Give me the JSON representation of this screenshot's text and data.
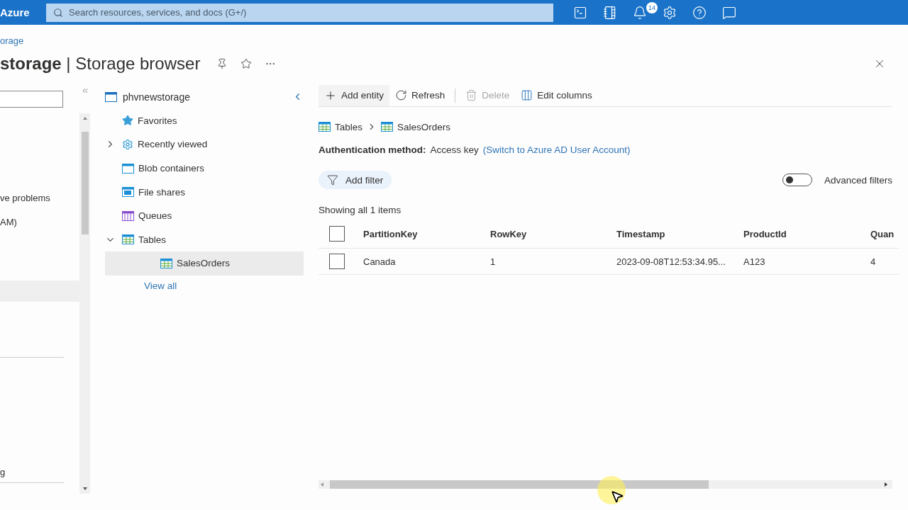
{
  "top_bar": {
    "brand": "Azure",
    "search": {
      "placeholder": "Search resources, services, and docs (G+/)"
    },
    "notification_count": "14"
  },
  "breadcrumb": "orage",
  "title": {
    "resource": "storage",
    "separator": " | ",
    "page": "Storage browser"
  },
  "left_nav": [
    {
      "label": "ve problems",
      "selected": false
    },
    {
      "label": "AM)",
      "selected": false
    },
    {
      "selected": true
    },
    {
      "label": "g",
      "selected": false
    }
  ],
  "tree": {
    "root": "phvnewstorage",
    "items": [
      {
        "kind": "favorites",
        "label": "Favorites",
        "selected": false
      },
      {
        "kind": "recent",
        "label": "Recently viewed",
        "expanded": false,
        "selected": false
      },
      {
        "kind": "blob",
        "label": "Blob containers",
        "selected": false
      },
      {
        "kind": "files",
        "label": "File shares",
        "selected": false
      },
      {
        "kind": "queue",
        "label": "Queues",
        "selected": false
      },
      {
        "kind": "table",
        "label": "Tables",
        "expanded": true,
        "selected": false,
        "children": [
          {
            "kind": "table",
            "label": "SalesOrders",
            "selected": true
          }
        ]
      }
    ],
    "view_all": "View all"
  },
  "toolbar": [
    {
      "kind": "add",
      "label": "Add entity",
      "disabled": false
    },
    {
      "kind": "refresh",
      "label": "Refresh",
      "disabled": false
    },
    {
      "kind": "delete",
      "label": "Delete",
      "disabled": true
    },
    {
      "kind": "columns",
      "label": "Edit columns",
      "disabled": false
    }
  ],
  "path": [
    "Tables",
    "SalesOrders"
  ],
  "auth": {
    "label": "Authentication method:",
    "value": "Access key",
    "link": "(Switch to Azure AD User Account)"
  },
  "filter": {
    "add_filter": "Add filter",
    "advanced": {
      "label": "Advanced filters",
      "on": false
    }
  },
  "count": "Showing all 1 items",
  "table": {
    "select_all": {
      "checked": false
    },
    "columns": [
      "PartitionKey",
      "RowKey",
      "Timestamp",
      "ProductId",
      "Quan"
    ],
    "rows": [
      {
        "checked": false,
        "cells": [
          "Canada",
          "1",
          "2023-09-08T12:53:34.95...",
          "A123",
          "4"
        ]
      }
    ]
  }
}
